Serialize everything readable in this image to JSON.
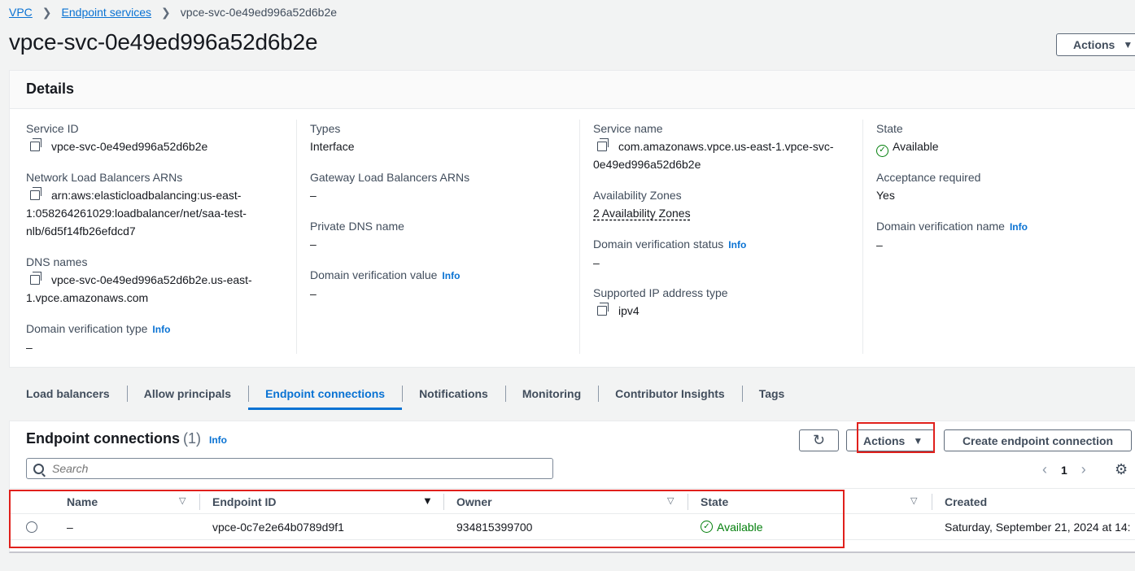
{
  "breadcrumb": {
    "items": [
      "VPC",
      "Endpoint services"
    ],
    "current": "vpce-svc-0e49ed996a52d6b2e"
  },
  "page_title": "vpce-svc-0e49ed996a52d6b2e",
  "header_actions_label": "Actions",
  "details": {
    "title": "Details",
    "service_id": {
      "label": "Service ID",
      "value": "vpce-svc-0e49ed996a52d6b2e"
    },
    "nlb_arns": {
      "label": "Network Load Balancers ARNs",
      "value_line1": "arn:aws:elasticloadbalancing:us-east-",
      "value_line2": "1:058264261029:loadbalancer/net/saa-test-",
      "value_line3": "nlb/6d5f14fb26efdcd7"
    },
    "dns_names": {
      "label": "DNS names",
      "value_line1": "vpce-svc-0e49ed996a52d6b2e.us-east-",
      "value_line2": "1.vpce.amazonaws.com"
    },
    "domain_verification_type": {
      "label": "Domain verification type",
      "info": "Info",
      "value": "–"
    },
    "types": {
      "label": "Types",
      "value": "Interface"
    },
    "gwlb_arns": {
      "label": "Gateway Load Balancers ARNs",
      "value": "–"
    },
    "private_dns_name": {
      "label": "Private DNS name",
      "value": "–"
    },
    "domain_verification_value": {
      "label": "Domain verification value",
      "info": "Info",
      "value": "–"
    },
    "service_name": {
      "label": "Service name",
      "value_line1": "com.amazonaws.vpce.us-east-1.vpce-svc-",
      "value_line2": "0e49ed996a52d6b2e"
    },
    "availability_zones": {
      "label": "Availability Zones",
      "value": "2 Availability Zones"
    },
    "domain_verification_status": {
      "label": "Domain verification status",
      "info": "Info",
      "value": "–"
    },
    "supported_ip": {
      "label": "Supported IP address type",
      "value": "ipv4"
    },
    "state": {
      "label": "State",
      "value": "Available"
    },
    "acceptance_required": {
      "label": "Acceptance required",
      "value": "Yes"
    },
    "domain_verification_name": {
      "label": "Domain verification name",
      "info": "Info",
      "value": "–"
    }
  },
  "tabs": [
    "Load balancers",
    "Allow principals",
    "Endpoint connections",
    "Notifications",
    "Monitoring",
    "Contributor Insights",
    "Tags"
  ],
  "active_tab": "Endpoint connections",
  "connections": {
    "title": "Endpoint connections",
    "count": "(1)",
    "info": "Info",
    "actions_label": "Actions",
    "create_label": "Create endpoint connection",
    "search_placeholder": "Search",
    "page": "1",
    "columns": [
      "Name",
      "Endpoint ID",
      "Owner",
      "State",
      "Created"
    ],
    "rows": [
      {
        "name": "–",
        "endpoint_id": "vpce-0c7e2e64b0789d9f1",
        "owner": "934815399700",
        "state": "Available",
        "created": "Saturday, September 21, 2024 at 14:"
      }
    ]
  },
  "colors": {
    "link": "#0972d3",
    "success": "#037f0c",
    "highlight": "#e0201c"
  }
}
